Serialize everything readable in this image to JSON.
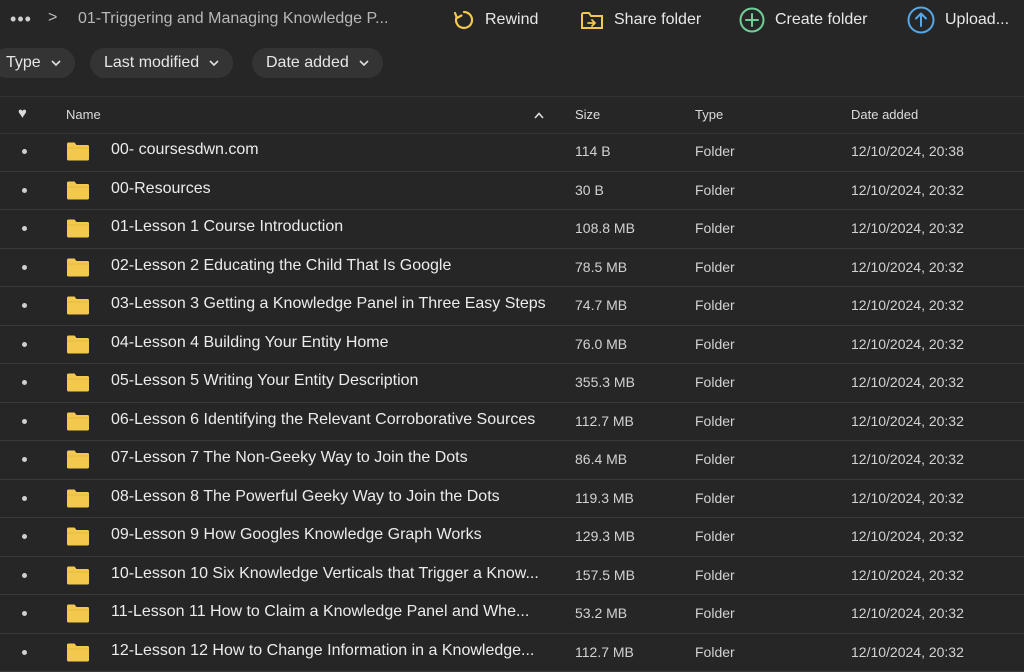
{
  "topbar": {
    "more_label": "•••",
    "crumb_separator": ">",
    "breadcrumb": "01-Triggering and Managing Knowledge P...",
    "rewind_label": "Rewind",
    "share_label": "Share folder",
    "create_label": "Create folder",
    "upload_label": "Upload..."
  },
  "filters": {
    "type_label": "Type",
    "last_modified_label": "Last modified",
    "date_added_label": "Date added"
  },
  "table": {
    "headers": {
      "favorite": "♥",
      "name": "Name",
      "sort_indicator": "^",
      "size": "Size",
      "type": "Type",
      "date_added": "Date added"
    },
    "rows": [
      {
        "name": "00- coursesdwn.com",
        "size": "114 B",
        "type": "Folder",
        "date": "12/10/2024, 20:38"
      },
      {
        "name": "00-Resources",
        "size": "30 B",
        "type": "Folder",
        "date": "12/10/2024, 20:32"
      },
      {
        "name": "01-Lesson 1 Course Introduction",
        "size": "108.8 MB",
        "type": "Folder",
        "date": "12/10/2024, 20:32"
      },
      {
        "name": "02-Lesson 2 Educating the Child That Is Google",
        "size": "78.5 MB",
        "type": "Folder",
        "date": "12/10/2024, 20:32"
      },
      {
        "name": "03-Lesson 3 Getting a Knowledge Panel in Three Easy Steps",
        "size": "74.7 MB",
        "type": "Folder",
        "date": "12/10/2024, 20:32"
      },
      {
        "name": "04-Lesson 4 Building Your Entity Home",
        "size": "76.0 MB",
        "type": "Folder",
        "date": "12/10/2024, 20:32"
      },
      {
        "name": "05-Lesson 5 Writing Your Entity Description",
        "size": "355.3 MB",
        "type": "Folder",
        "date": "12/10/2024, 20:32"
      },
      {
        "name": "06-Lesson 6 Identifying the Relevant Corroborative Sources",
        "size": "112.7 MB",
        "type": "Folder",
        "date": "12/10/2024, 20:32"
      },
      {
        "name": "07-Lesson 7 The Non-Geeky Way to Join the Dots",
        "size": "86.4 MB",
        "type": "Folder",
        "date": "12/10/2024, 20:32"
      },
      {
        "name": "08-Lesson 8 The Powerful Geeky Way to Join the Dots",
        "size": "119.3 MB",
        "type": "Folder",
        "date": "12/10/2024, 20:32"
      },
      {
        "name": "09-Lesson 9 How Googles Knowledge Graph Works",
        "size": "129.3 MB",
        "type": "Folder",
        "date": "12/10/2024, 20:32"
      },
      {
        "name": "10-Lesson 10 Six Knowledge Verticals that Trigger a Know...",
        "size": "157.5 MB",
        "type": "Folder",
        "date": "12/10/2024, 20:32"
      },
      {
        "name": "11-Lesson 11 How to Claim a Knowledge Panel and Whe...",
        "size": "53.2 MB",
        "type": "Folder",
        "date": "12/10/2024, 20:32"
      },
      {
        "name": "12-Lesson 12 How to Change Information in a Knowledge...",
        "size": "112.7 MB",
        "type": "Folder",
        "date": "12/10/2024, 20:32"
      }
    ]
  },
  "colors": {
    "background": "#262626",
    "folder": "#f2c94c",
    "rewind_icon": "#f2c94c",
    "share_icon": "#f2c94c",
    "create_icon": "#6fcf97",
    "upload_icon": "#56a8e8"
  }
}
